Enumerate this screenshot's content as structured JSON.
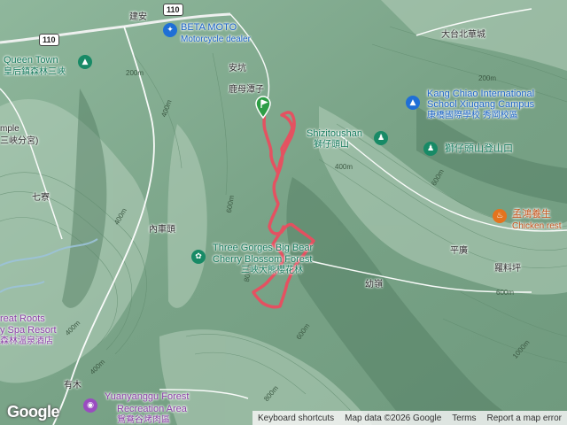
{
  "map": {
    "colors": {
      "terrain": "#7fa98f",
      "ridge_light": "#b9d3bf",
      "valley_dark": "#4f7a60",
      "road": "#ffffff",
      "river": "#9cc3da",
      "track": "#ea4d5f"
    },
    "road_shields": [
      {
        "id": "110-top",
        "text": "110"
      },
      {
        "id": "110-left",
        "text": "110"
      }
    ],
    "places": {
      "jianan": "建安",
      "ankeng": "安坑",
      "lumutanzi": "鹿母潭子",
      "qiliao": "七寮",
      "neichetou": "內車頭",
      "pingguang": "平廣",
      "luoliaoping": "羅料坪",
      "youling": "幼嶺",
      "youmu": "有木",
      "datai_beihua": "大台北華城",
      "mple": "mple",
      "xiafenggong": "三峽分宮)"
    },
    "pois": {
      "beta_moto": {
        "title": "BETA MOTO",
        "subtitle": "Motorcycle dealer",
        "icon": "motorcycle-icon"
      },
      "queen_town": {
        "title": "Queen Town",
        "subtitle": "皇后鎮森林三峽",
        "icon": "park-icon"
      },
      "kang_chiao": {
        "title": "Kang Chiao International",
        "line2": "School Xiugang Campus",
        "subtitle": "康橋國際學校 秀岡校區",
        "icon": "school-icon"
      },
      "shizitoushan": {
        "title": "Shizitoushan",
        "subtitle": "獅仔頭山",
        "icon": "hiking-icon"
      },
      "shizitou_trailhead": {
        "title": "獅仔頭山登山口",
        "icon": "hiking-icon"
      },
      "menghong": {
        "title": "孟鴻養生",
        "subtitle": "Chicken rest",
        "icon": "restaurant-icon"
      },
      "bigbear": {
        "title": "Three Gorges Big Bear",
        "line2": "Cherry Blossom Forest",
        "subtitle": "三峽大熊櫻花林",
        "icon": "flower-icon"
      },
      "great_roots": {
        "title": "reat Roots",
        "line2": "y Spa Resort",
        "subtitle": "森林溫泉酒店"
      },
      "yuanyanggu": {
        "title": "Yuanyanggu Forest",
        "line2": "Recreation Area",
        "subtitle": "鴛鴦谷烤肉區",
        "icon": "camera-icon"
      }
    },
    "elevations": [
      "200m",
      "400m",
      "600m",
      "800m",
      "400m",
      "400m",
      "600m",
      "600m",
      "200m",
      "600m",
      "800m",
      "1000m",
      "400m",
      "400m"
    ],
    "start_marker": {
      "icon": "start-flag-icon"
    },
    "footer": {
      "logo": "Google",
      "shortcuts": "Keyboard shortcuts",
      "mapdata": "Map data ©2026 Google",
      "terms": "Terms",
      "report": "Report a map error"
    }
  }
}
